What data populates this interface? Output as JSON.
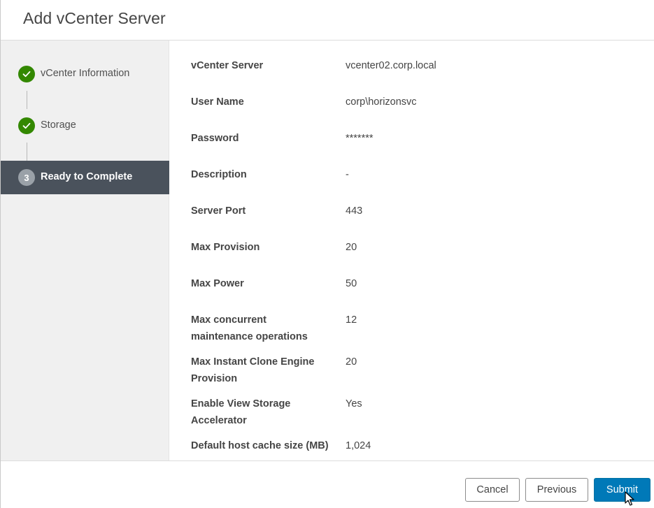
{
  "header": {
    "title": "Add vCenter Server"
  },
  "steps": [
    {
      "label": "vCenter Information",
      "status": "complete",
      "icon": "check-icon"
    },
    {
      "label": "Storage",
      "status": "complete",
      "icon": "check-icon"
    },
    {
      "label": "Ready to Complete",
      "status": "active",
      "number": "3"
    }
  ],
  "summary": [
    {
      "label": "vCenter Server",
      "value": "vcenter02.corp.local"
    },
    {
      "label": "User Name",
      "value": "corp\\horizonsvc"
    },
    {
      "label": "Password",
      "value": "*******"
    },
    {
      "label": "Description",
      "value": "-"
    },
    {
      "label": "Server Port",
      "value": "443"
    },
    {
      "label": "Max Provision",
      "value": "20"
    },
    {
      "label": "Max Power",
      "value": "50"
    },
    {
      "label": "Max concurrent maintenance operations",
      "value": "12"
    },
    {
      "label": "Max Instant Clone Engine Provision",
      "value": "20"
    },
    {
      "label": "Enable View Storage Accelerator",
      "value": "Yes"
    },
    {
      "label": "Default host cache size (MB)",
      "value": "1,024"
    }
  ],
  "footer": {
    "cancel_label": "Cancel",
    "previous_label": "Previous",
    "submit_label": "Submit"
  },
  "colors": {
    "step_complete": "#338800",
    "step_active_bg": "#4a525c",
    "primary_button": "#0079b8"
  }
}
